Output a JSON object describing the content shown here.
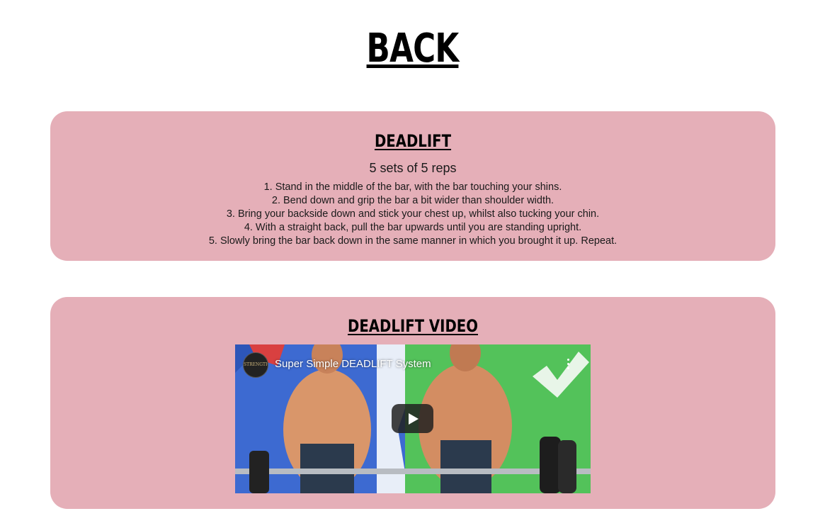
{
  "page": {
    "title": "BACK"
  },
  "exercise": {
    "heading": "DEADLIFT",
    "sets": "5 sets of 5 reps",
    "steps": [
      "1. Stand in the middle of the bar, with the bar touching your shins.",
      "2. Bend down and grip the bar a bit wider than shoulder width.",
      "3. Bring your backside down and stick your chest up, whilst also tucking your chin.",
      "4. With a straight back, pull the bar upwards until you are standing upright.",
      "5. Slowly bring the bar back down in the same manner in which you brought it up. Repeat."
    ]
  },
  "video_section": {
    "heading": "DEADLIFT VIDEO",
    "video": {
      "title": "Super Simple DEADLIFT System",
      "channel_avatar_text": "STRENGTH CAMP",
      "play_icon": "play-icon",
      "menu_icon": "more-vert-icon"
    }
  },
  "colors": {
    "card_background": "#e5afb8",
    "page_background": "#ffffff"
  }
}
